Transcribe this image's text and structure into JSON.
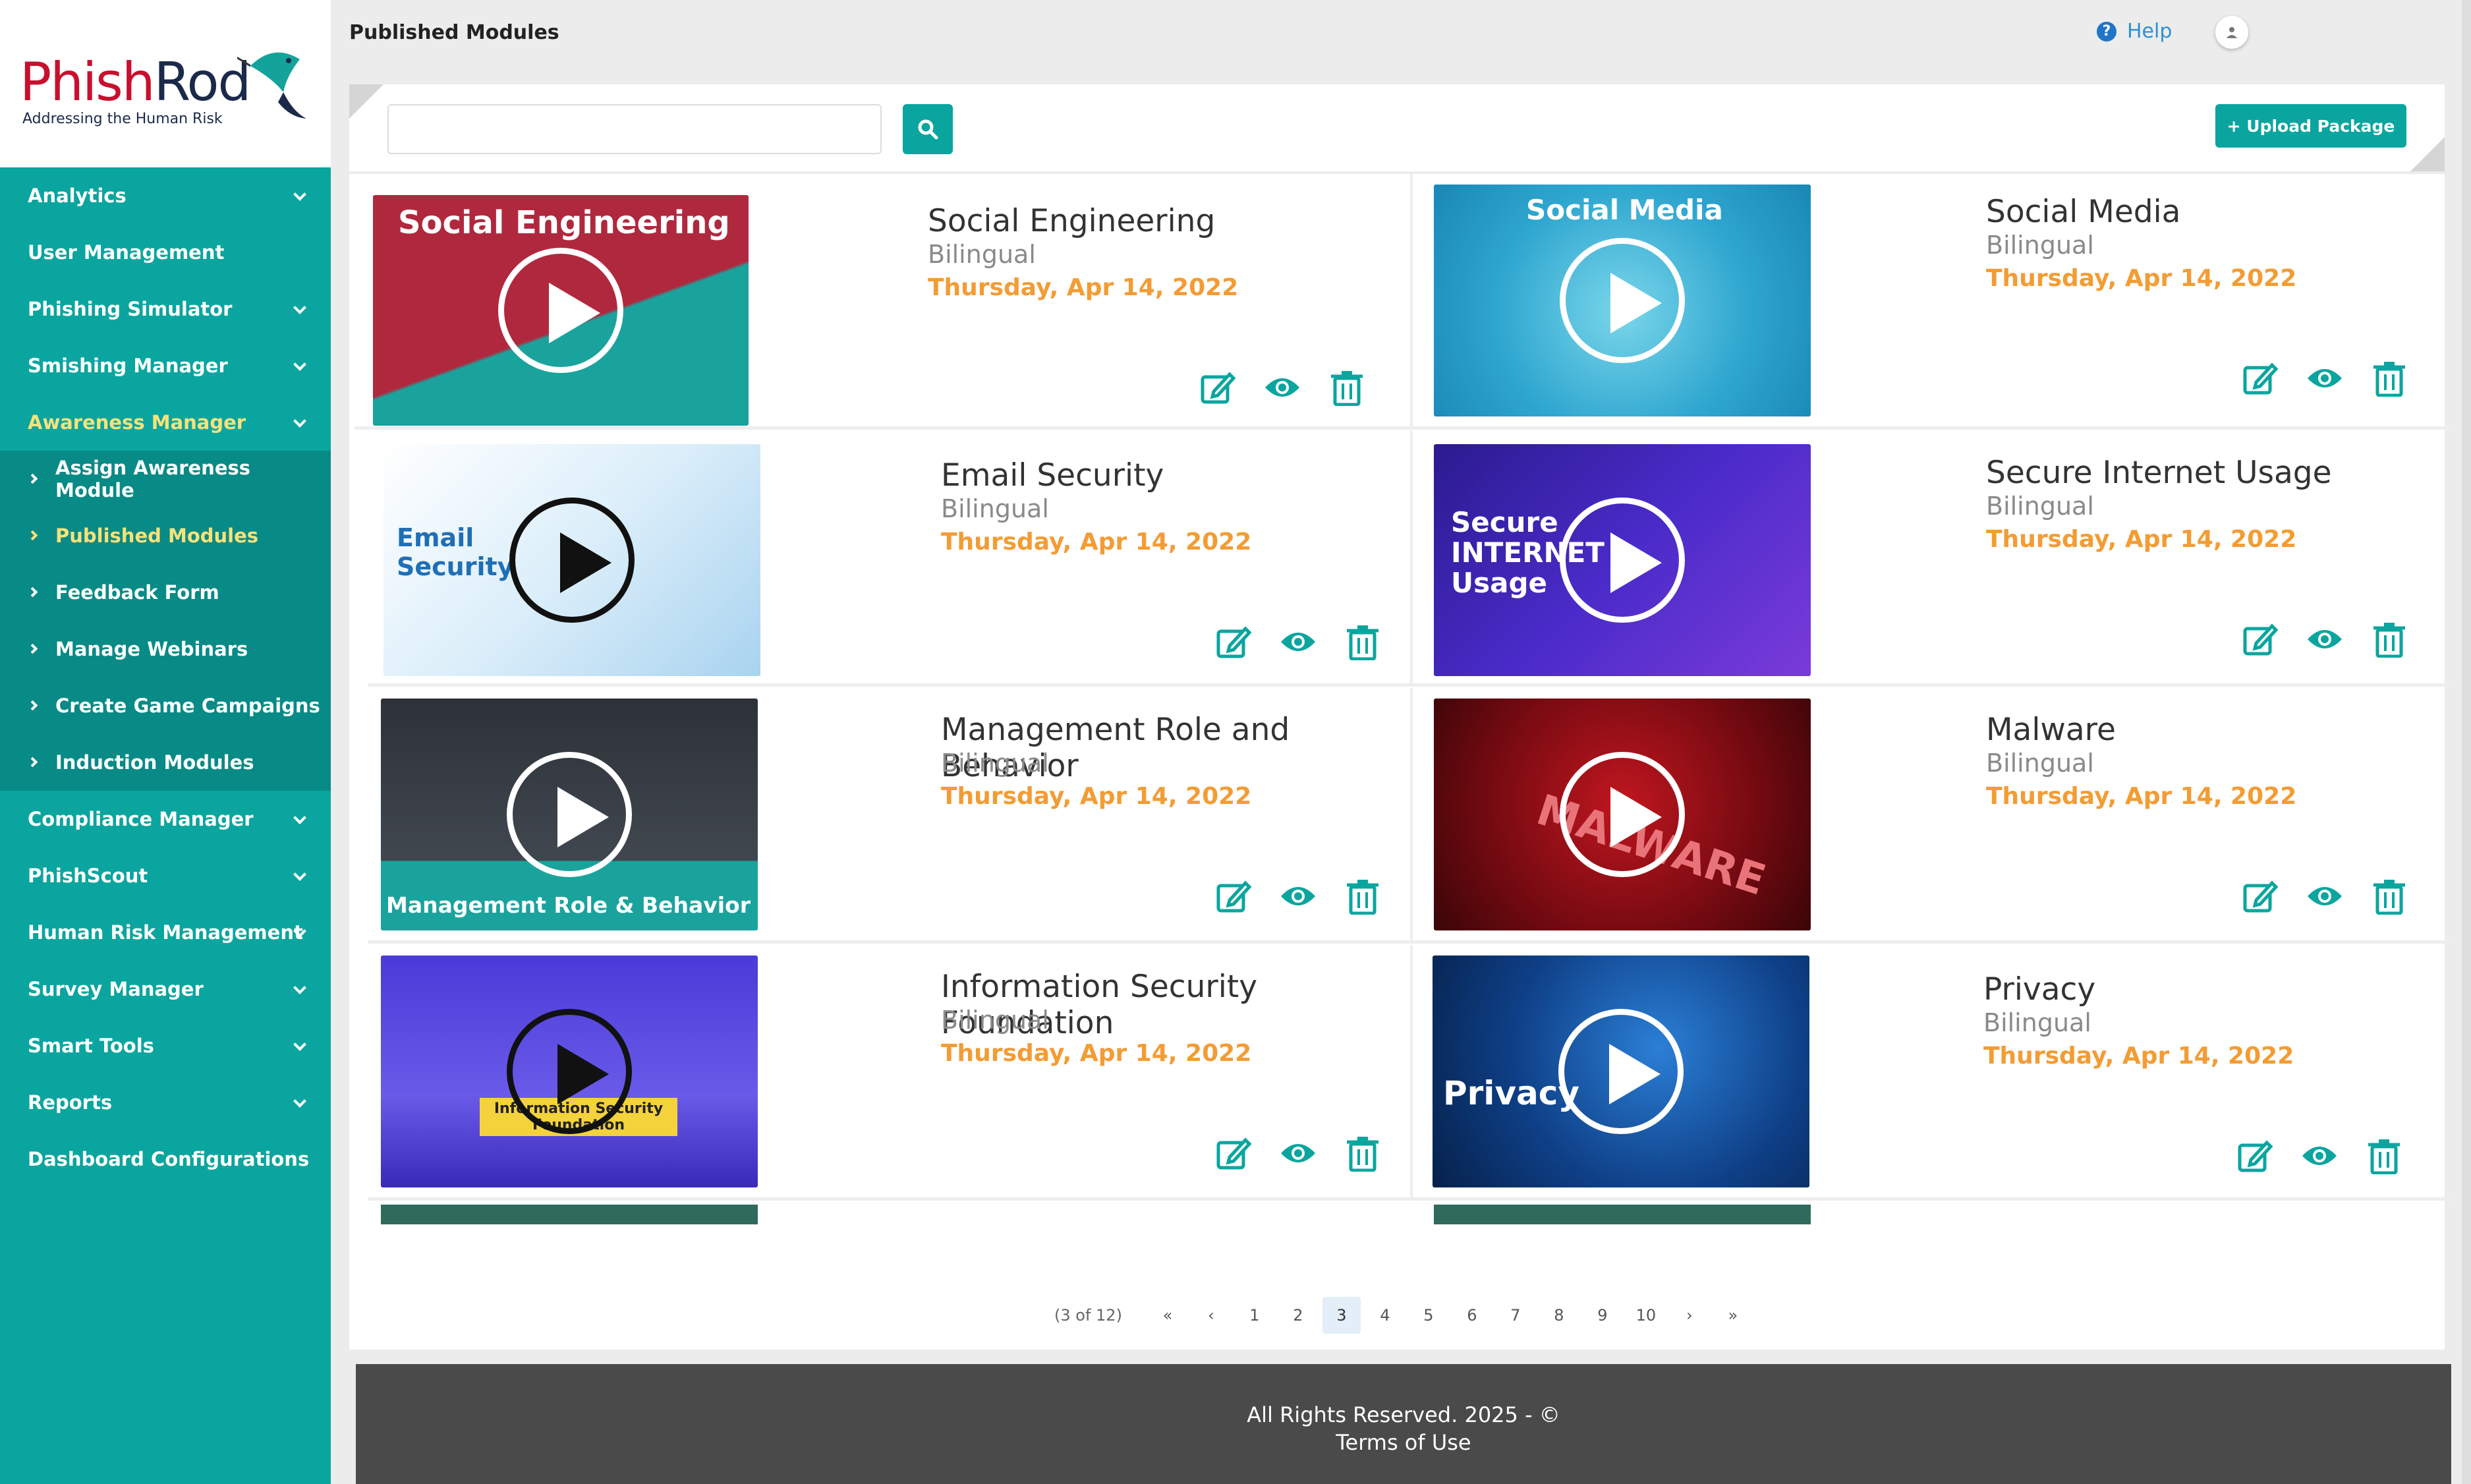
{
  "app": {
    "logo_brand_a": "Phish",
    "logo_brand_b": "Rod",
    "logo_tagline": "Addressing the Human Risk"
  },
  "header": {
    "title": "Published Modules",
    "help_label": "Help"
  },
  "sidebar": {
    "items": [
      {
        "label": "Analytics"
      },
      {
        "label": "User Management"
      },
      {
        "label": "Phishing Simulator"
      },
      {
        "label": "Smishing Manager"
      },
      {
        "label": "Awareness Manager"
      },
      {
        "label": "Compliance Manager"
      },
      {
        "label": "PhishScout"
      },
      {
        "label": "Human Risk Management"
      },
      {
        "label": "Survey Manager"
      },
      {
        "label": "Smart Tools"
      },
      {
        "label": "Reports"
      },
      {
        "label": "Dashboard Configurations"
      }
    ],
    "subitems": [
      {
        "label": "Assign Awareness Module"
      },
      {
        "label": "Published Modules"
      },
      {
        "label": "Feedback Form"
      },
      {
        "label": "Manage Webinars"
      },
      {
        "label": "Create Game Campaigns"
      },
      {
        "label": "Induction Modules"
      }
    ]
  },
  "toolbar": {
    "search_value": "",
    "upload_label": "+ Upload Package"
  },
  "modules": [
    {
      "title": "Social Engineering",
      "language": "Bilingual",
      "date": "Thursday, Apr 14, 2022",
      "thumb_text": "Social Engineering"
    },
    {
      "title": "Social Media",
      "language": "Bilingual",
      "date": "Thursday, Apr 14, 2022",
      "thumb_text": "Social Media"
    },
    {
      "title": "Email Security",
      "language": "Bilingual",
      "date": "Thursday, Apr 14, 2022",
      "thumb_text": "Email Security"
    },
    {
      "title": "Secure Internet Usage",
      "language": "Bilingual",
      "date": "Thursday, Apr 14, 2022",
      "thumb_text": "Secure INTERNET Usage"
    },
    {
      "title": "Management Role and Behavior",
      "language": "Bilingual",
      "date": "Thursday, Apr 14, 2022",
      "thumb_text": "Management Role & Behavior"
    },
    {
      "title": "Malware",
      "language": "Bilingual",
      "date": "Thursday, Apr 14, 2022",
      "thumb_text": "MALWARE"
    },
    {
      "title": "Information Security Foundation",
      "language": "Bilingual",
      "date": "Thursday, Apr 14, 2022",
      "thumb_text": "Information Security Foundation"
    },
    {
      "title": "Privacy",
      "language": "Bilingual",
      "date": "Thursday, Apr 14, 2022",
      "thumb_text": "Privacy"
    }
  ],
  "pagination": {
    "info": "(3 of 12)",
    "first": "«",
    "prev": "‹",
    "next": "›",
    "last": "»",
    "pages": [
      "1",
      "2",
      "3",
      "4",
      "5",
      "6",
      "7",
      "8",
      "9",
      "10"
    ],
    "current": "3"
  },
  "footer": {
    "line1": "All Rights Reserved. 2025 - ©",
    "line2": "Terms of Use"
  },
  "colors": {
    "primary": "#0aa59f",
    "sidebar_sub": "#088a86",
    "active": "#f6e27a",
    "date": "#f39c34"
  }
}
